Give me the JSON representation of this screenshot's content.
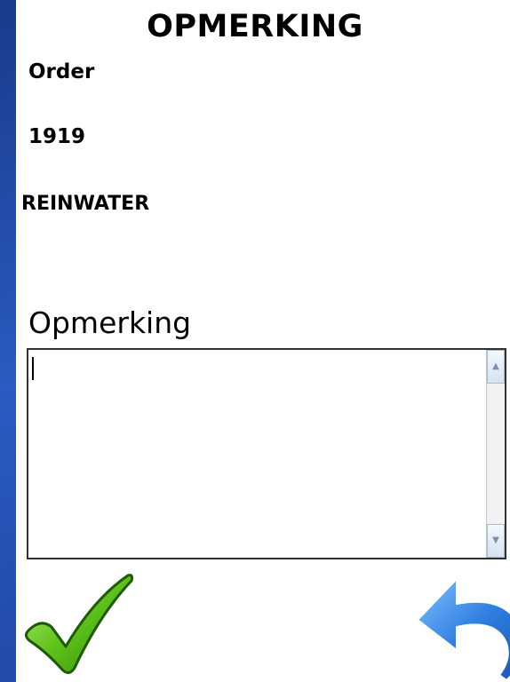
{
  "header": {
    "title": "OPMERKING"
  },
  "order": {
    "label": "Order",
    "number": "1919",
    "description": "REINWATER"
  },
  "remark": {
    "label": "Opmerking",
    "value": ""
  },
  "icons": {
    "ok": "checkmark-icon",
    "undo": "undo-arrow-icon",
    "scroll_up": "scroll-up-icon",
    "scroll_down": "scroll-down-icon"
  },
  "colors": {
    "background": "#2a5bc0",
    "check_green": "#5ec21a",
    "undo_blue": "#2f7fe0"
  }
}
